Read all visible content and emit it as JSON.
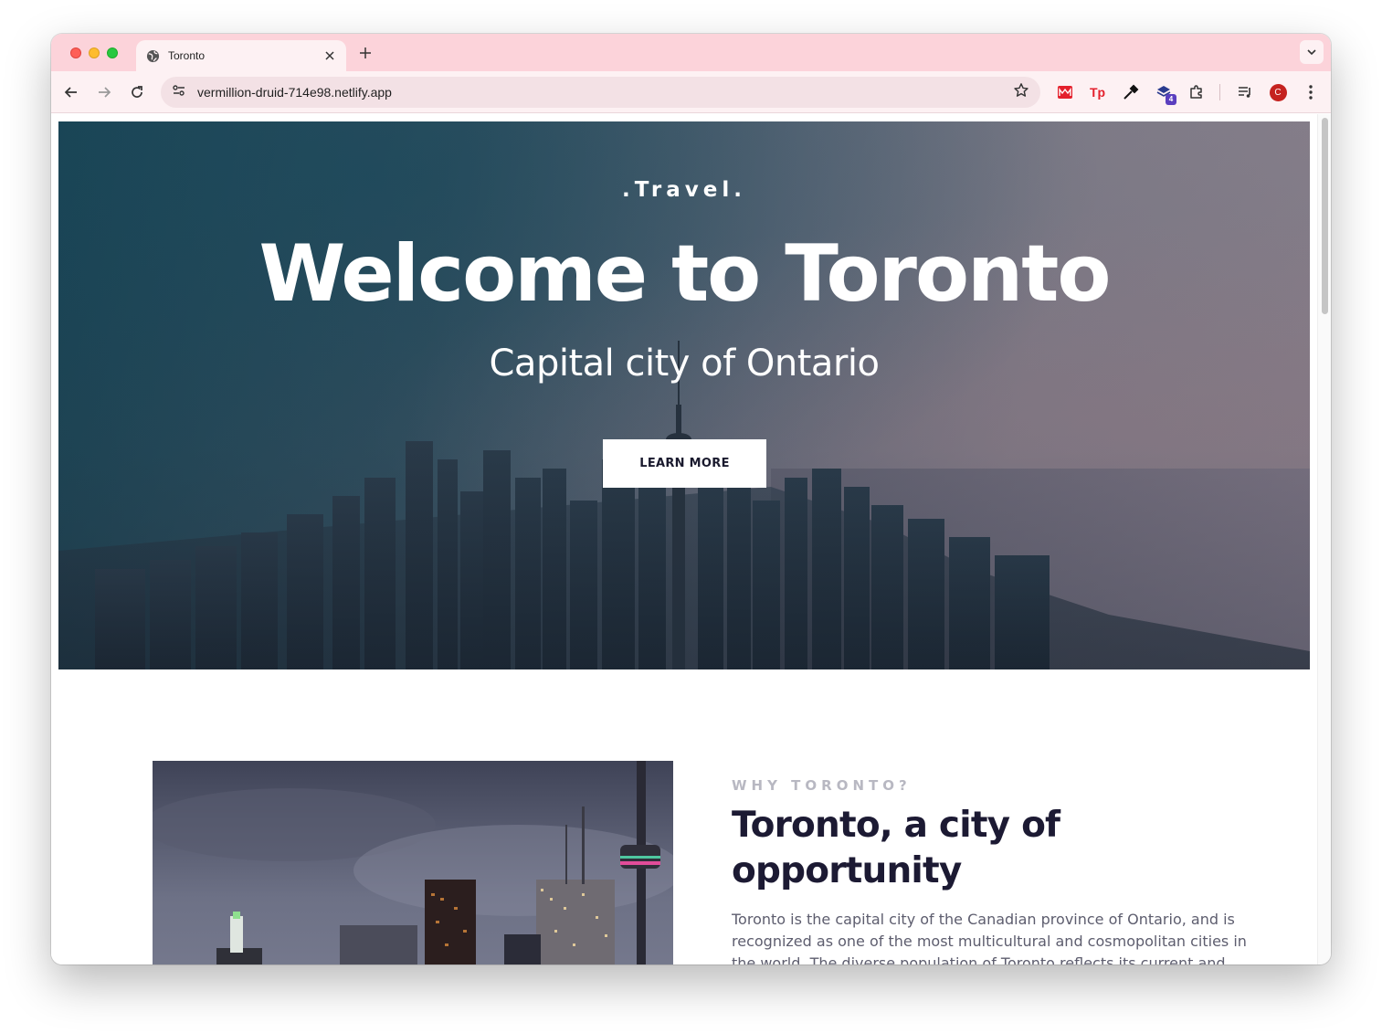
{
  "browser": {
    "tab_title": "Toronto",
    "url": "vermillion-druid-714e98.netlify.app",
    "profile_initial": "C",
    "extension_badge": "4",
    "colors": {
      "tabstrip": "#fcd3da",
      "toolbar": "#fdf1f3",
      "omnibox": "#f3e1e5"
    }
  },
  "hero": {
    "eyebrow": ".Travel.",
    "title": "Welcome to Toronto",
    "subtitle": "Capital city of Ontario",
    "button_label": "LEARN MORE"
  },
  "about": {
    "eyebrow": "WHY TORONTO?",
    "heading": "Toronto, a city of opportunity",
    "body": "Toronto is the capital city of the Canadian province of Ontario, and is recognized as one of the most multicultural and cosmopolitan cities in the world. The diverse population of Toronto reflects its current and"
  },
  "colors": {
    "heading": "#1c1a33",
    "body_text": "#5d5d6e",
    "eyebrow": "#b8b8c2"
  }
}
